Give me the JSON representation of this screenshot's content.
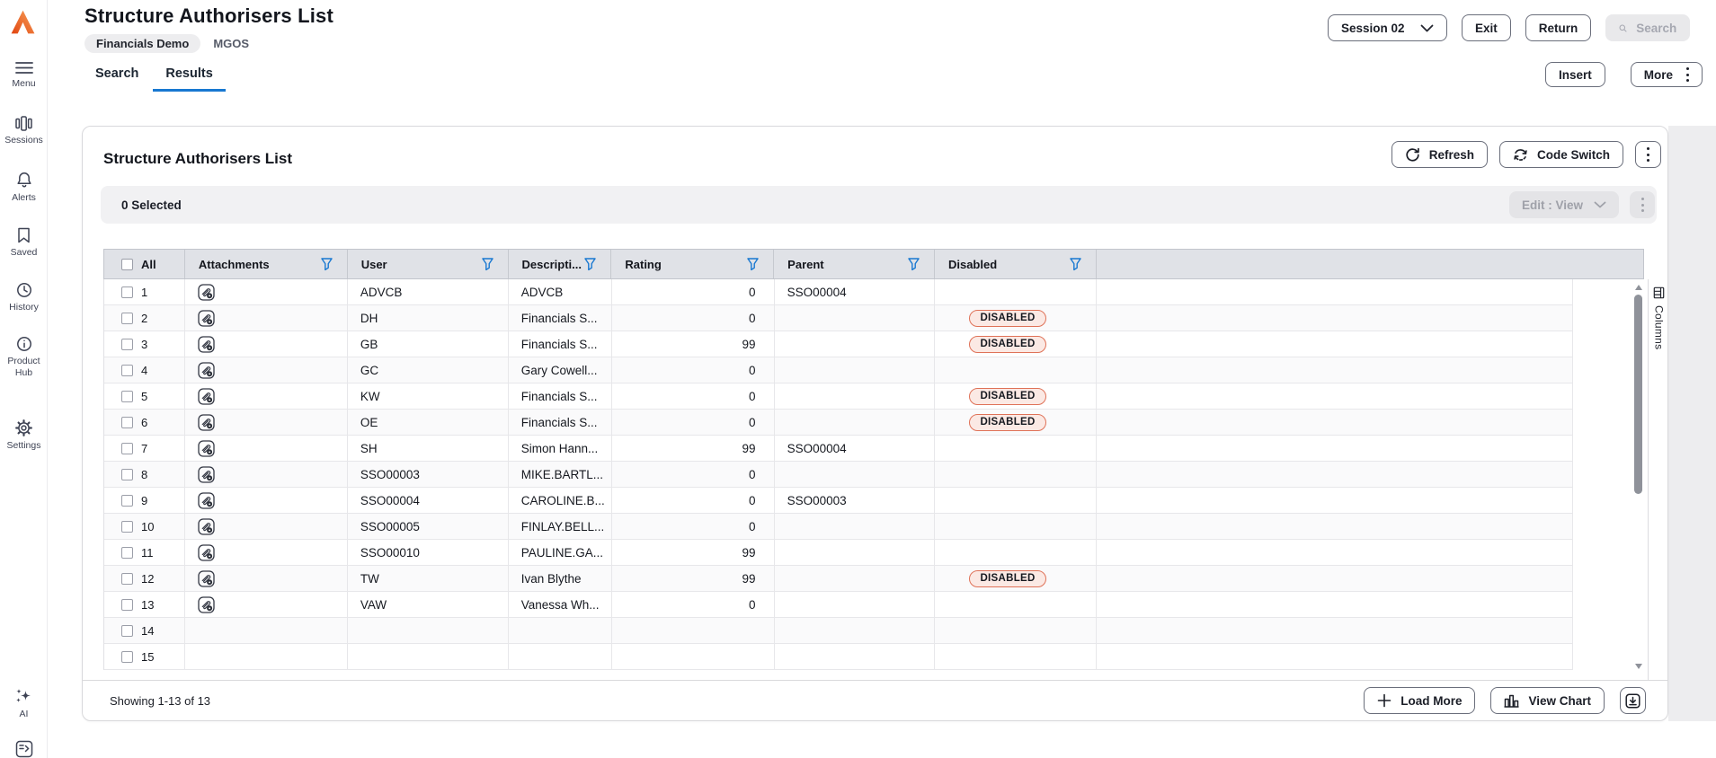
{
  "colors": {
    "accent_blue": "#1878d1",
    "logo_gradient_start": "#e1440f",
    "logo_gradient_end": "#f8a25b",
    "badge_background": "#fbe9e4",
    "badge_border": "#df7258"
  },
  "sidebar": {
    "items": [
      {
        "label": "Menu",
        "icon": "menu-icon"
      },
      {
        "label": "Sessions",
        "icon": "sessions-icon"
      },
      {
        "label": "Alerts",
        "icon": "bell-icon"
      },
      {
        "label": "Saved",
        "icon": "bookmark-icon"
      },
      {
        "label": "History",
        "icon": "clock-icon"
      },
      {
        "label": "Product Hub",
        "icon": "info-icon"
      },
      {
        "label": "Settings",
        "icon": "gear-icon"
      },
      {
        "label": "AI",
        "icon": "sparkles-icon"
      }
    ]
  },
  "header": {
    "title": "Structure Authorisers List",
    "environment_badge": "Financials Demo",
    "environment_code": "MGOS",
    "session_button_label": "Session 02",
    "exit_label": "Exit",
    "return_label": "Return",
    "search_label": "Search",
    "insert_label": "Insert",
    "more_label": "More"
  },
  "tabs": [
    {
      "label": "Search",
      "active": false
    },
    {
      "label": "Results",
      "active": true
    }
  ],
  "panel": {
    "title": "Structure Authorisers List",
    "refresh_label": "Refresh",
    "code_switch_label": "Code Switch",
    "selected_text": "0 Selected",
    "edit_mode_label": "Edit : View",
    "columns_tab_label": "Columns"
  },
  "table": {
    "select_all_label": "All",
    "badge_label": "DISABLED",
    "columns": [
      {
        "label": "Attachments",
        "filter": true
      },
      {
        "label": "User",
        "filter": true
      },
      {
        "label": "Descripti...",
        "filter": true
      },
      {
        "label": "Rating",
        "filter": true
      },
      {
        "label": "Parent",
        "filter": true
      },
      {
        "label": "Disabled",
        "filter": true
      }
    ],
    "rows": [
      {
        "num": "1",
        "attachment": true,
        "user": "ADVCB",
        "description": "ADVCB",
        "rating": "0",
        "parent": "SSO00004",
        "disabled": false
      },
      {
        "num": "2",
        "attachment": true,
        "user": "DH",
        "description": "Financials S...",
        "rating": "0",
        "parent": "",
        "disabled": true
      },
      {
        "num": "3",
        "attachment": true,
        "user": "GB",
        "description": "Financials S...",
        "rating": "99",
        "parent": "",
        "disabled": true
      },
      {
        "num": "4",
        "attachment": true,
        "user": "GC",
        "description": "Gary Cowell...",
        "rating": "0",
        "parent": "",
        "disabled": false
      },
      {
        "num": "5",
        "attachment": true,
        "user": "KW",
        "description": "Financials S...",
        "rating": "0",
        "parent": "",
        "disabled": true
      },
      {
        "num": "6",
        "attachment": true,
        "user": "OE",
        "description": "Financials S...",
        "rating": "0",
        "parent": "",
        "disabled": true
      },
      {
        "num": "7",
        "attachment": true,
        "user": "SH",
        "description": "Simon Hann...",
        "rating": "99",
        "parent": "SSO00004",
        "disabled": false
      },
      {
        "num": "8",
        "attachment": true,
        "user": "SSO00003",
        "description": "MIKE.BARTL...",
        "rating": "0",
        "parent": "",
        "disabled": false
      },
      {
        "num": "9",
        "attachment": true,
        "user": "SSO00004",
        "description": "CAROLINE.B...",
        "rating": "0",
        "parent": "SSO00003",
        "disabled": false
      },
      {
        "num": "10",
        "attachment": true,
        "user": "SSO00005",
        "description": "FINLAY.BELL...",
        "rating": "0",
        "parent": "",
        "disabled": false
      },
      {
        "num": "11",
        "attachment": true,
        "user": "SSO00010",
        "description": "PAULINE.GA...",
        "rating": "99",
        "parent": "",
        "disabled": false
      },
      {
        "num": "12",
        "attachment": true,
        "user": "TW",
        "description": "Ivan Blythe",
        "rating": "99",
        "parent": "",
        "disabled": true
      },
      {
        "num": "13",
        "attachment": true,
        "user": "VAW",
        "description": "Vanessa Wh...",
        "rating": "0",
        "parent": "",
        "disabled": false
      },
      {
        "num": "14",
        "attachment": false,
        "user": "",
        "description": "",
        "rating": "",
        "parent": "",
        "disabled": false
      },
      {
        "num": "15",
        "attachment": false,
        "user": "",
        "description": "",
        "rating": "",
        "parent": "",
        "disabled": false
      }
    ]
  },
  "footer": {
    "showing_text": "Showing 1-13 of 13",
    "load_more_label": "Load More",
    "view_chart_label": "View Chart"
  }
}
